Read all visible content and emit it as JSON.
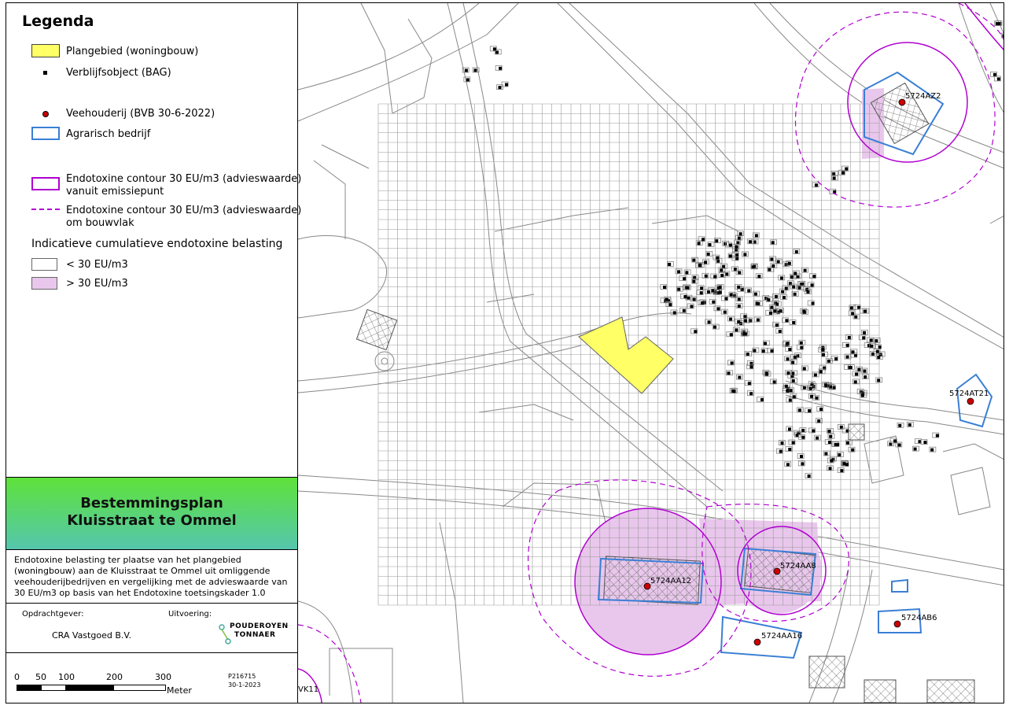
{
  "legend": {
    "title": "Legenda",
    "items": [
      {
        "label": "Plangebied (woningbouw)"
      },
      {
        "label": "Verblijfsobject (BAG)"
      },
      {
        "label": "Veehouderij (BVB 30-6-2022)"
      },
      {
        "label": "Agrarisch bedrijf"
      },
      {
        "label": "Endotoxine contour 30 EU/m3 (advieswaarde)",
        "label2": "vanuit emissiepunt"
      },
      {
        "label": "Endotoxine contour 30 EU/m3 (advieswaarde)",
        "label2": "om bouwvlak"
      }
    ],
    "subtitle": "Indicatieve cumulatieve endotoxine belasting",
    "classes": [
      {
        "label": "< 30 EU/m3"
      },
      {
        "label": "> 30 EU/m3"
      }
    ]
  },
  "colors": {
    "plangebied": "#ffff66",
    "veehouderij": "#cc0000",
    "agrarisch": "#3a7fd5",
    "contour": "#b000d0",
    "over30": "#e9c7ec",
    "title_top": "#5ee23a",
    "title_bottom": "#55c6ad"
  },
  "title_block": {
    "line1": "Bestemmingsplan",
    "line2": "Kluisstraat te Ommel"
  },
  "description": {
    "lines": [
      "Endotoxine belasting ter plaatse van het plangebied",
      "(woningbouw) aan de Kluisstraat te Ommel uit omliggende",
      "veehouderijbedrijven en vergelijking met de advieswaarde van",
      "30 EU/m3 op basis van het Endotoxine toetsingskader 1.0"
    ]
  },
  "client": {
    "opdrachtgever_label": "Opdrachtgever:",
    "opdrachtgever": "CRA Vastgoed B.V.",
    "uitvoering_label": "Uitvoering:",
    "logo_line1": "POUDEROYEN",
    "logo_line2": "TONNAER"
  },
  "scale": {
    "ticks": [
      "0",
      "50",
      "100",
      "200",
      "300"
    ],
    "unit": "Meter",
    "project": "P216715",
    "date": "30-1-2023"
  },
  "map": {
    "farms": [
      {
        "label": "5724AZ2"
      },
      {
        "label": "5724AT21"
      },
      {
        "label": "5724AA12"
      },
      {
        "label": "5724AA8"
      },
      {
        "label": "5724AA16"
      },
      {
        "label": "5724AB6"
      },
      {
        "label": "VK11"
      }
    ]
  }
}
